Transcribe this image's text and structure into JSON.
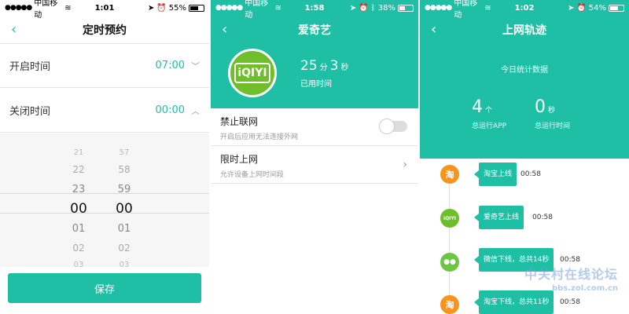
{
  "screen1": {
    "status": {
      "carrier": "中国移动",
      "time": "1:01",
      "battery": "55%",
      "battery_level": 0.55
    },
    "title": "定时预约",
    "open": {
      "label": "开启时间",
      "value": "07:00"
    },
    "close": {
      "label": "关闭时间",
      "value": "00:00"
    },
    "picker": {
      "hours": [
        "21",
        "22",
        "23",
        "00",
        "01",
        "02",
        "03"
      ],
      "minutes": [
        "57",
        "58",
        "59",
        "00",
        "01",
        "02",
        "03"
      ]
    },
    "save": "保存"
  },
  "screen2": {
    "status": {
      "carrier": "中国移动",
      "time": "1:58",
      "battery": "38%",
      "battery_level": 0.38
    },
    "title": "爱奇艺",
    "logo_text": "iQIYI",
    "usage": {
      "minutes": "25",
      "minutes_unit": "分",
      "seconds": "3",
      "seconds_unit": "秒",
      "caption": "已用时间"
    },
    "block": {
      "title": "禁止联网",
      "desc": "开启后应用无法连接外网"
    },
    "limit": {
      "title": "限时上网",
      "desc": "允许设备上网时间段"
    }
  },
  "screen3": {
    "status": {
      "carrier": "中国移动",
      "time": "1:02",
      "battery": "54%",
      "battery_level": 0.54
    },
    "title": "上网轨迹",
    "today": "今日统计数据",
    "apps": {
      "count": "4",
      "unit": "个",
      "caption": "总运行APP"
    },
    "runtime": {
      "count": "0",
      "unit": "秒",
      "caption": "总运行时间"
    },
    "events": [
      {
        "icon": "淘",
        "text": "淘宝上线",
        "time": "00:58"
      },
      {
        "icon": "iQIYI",
        "text": "爱奇艺上线",
        "time": "00:58"
      },
      {
        "icon": "●●",
        "text": "微信下线，总共14秒",
        "time": "00:58"
      },
      {
        "icon": "淘",
        "text": "淘宝下线，总共11秒",
        "time": "00:58"
      }
    ]
  },
  "watermark": {
    "line1": "中关村在线论坛",
    "line2": "bbs.zol.com.cn"
  },
  "colors": {
    "accent": "#1fbfa5",
    "qiyi_green": "#6fbe2c",
    "taobao_orange": "#f7931e"
  }
}
